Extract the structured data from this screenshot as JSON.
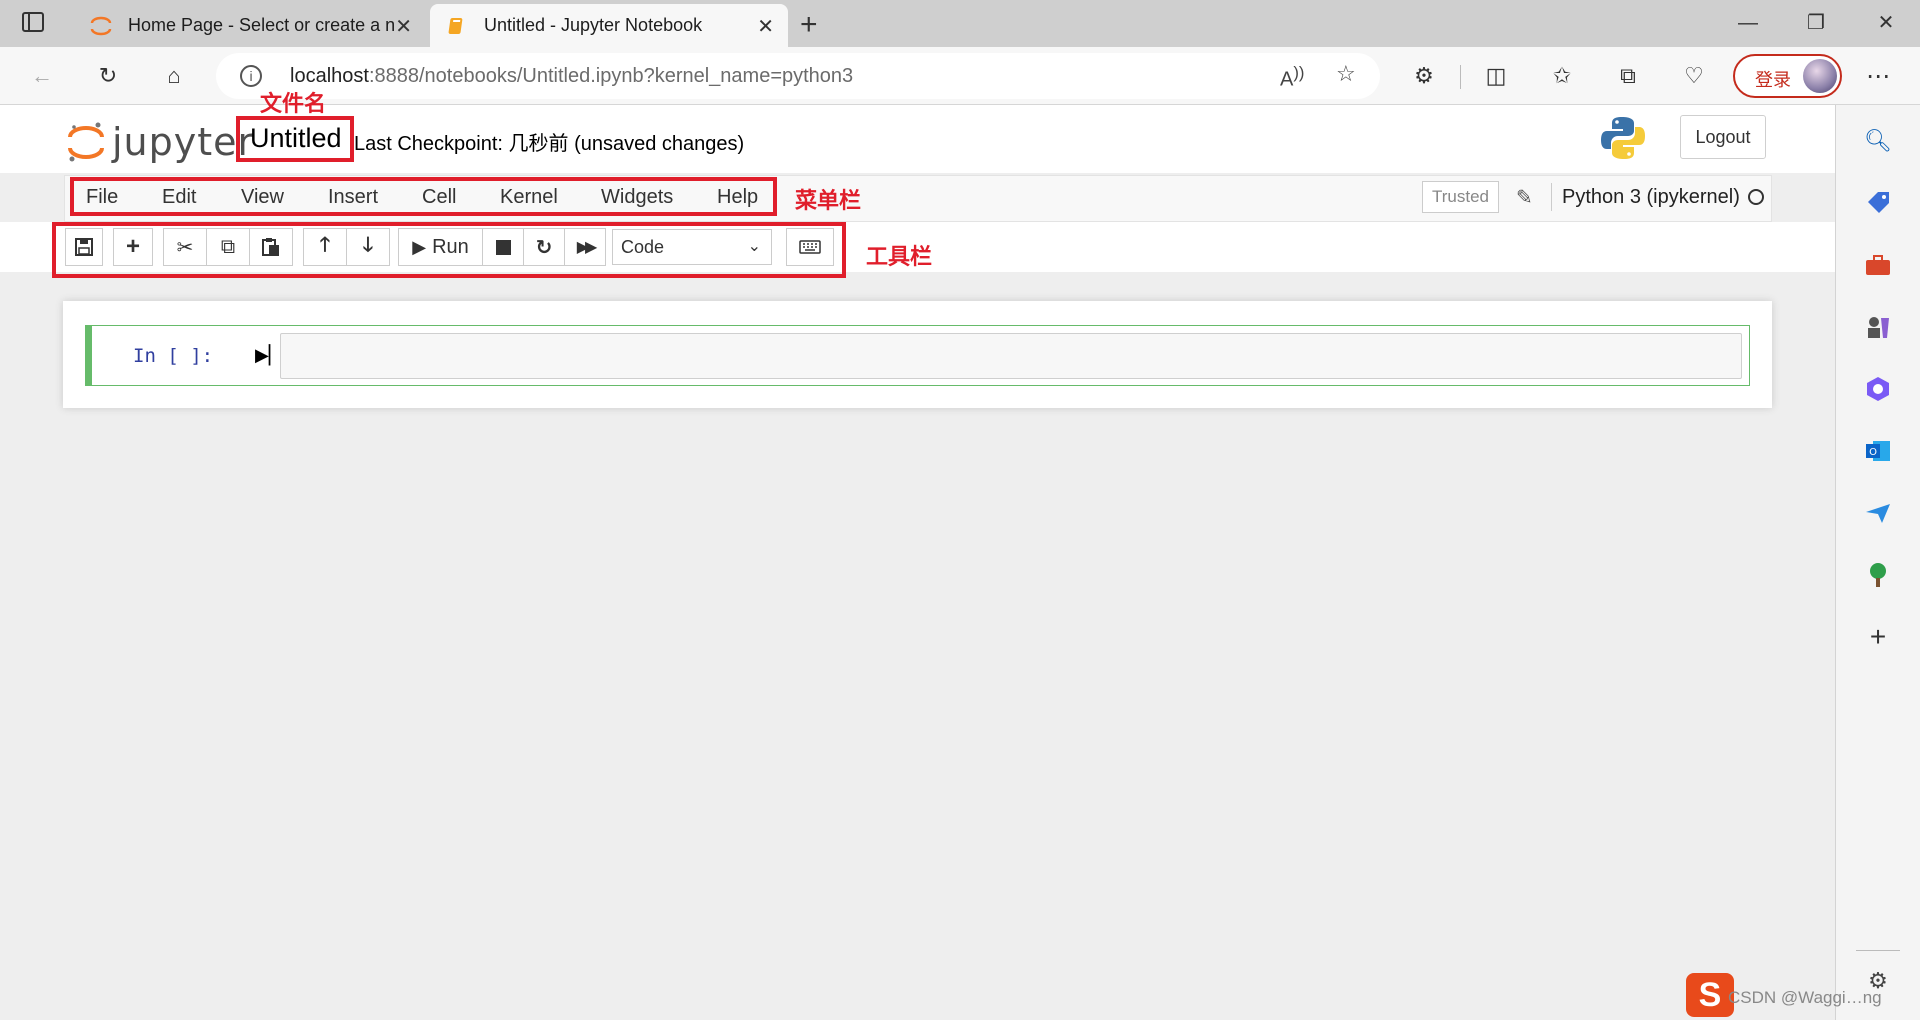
{
  "browser": {
    "tabs": [
      {
        "title": "Home Page - Select or create a n",
        "icon": "jupyter-icon",
        "active": false
      },
      {
        "title": "Untitled - Jupyter Notebook",
        "icon": "notebook-icon",
        "active": true
      }
    ],
    "url_host": "localhost",
    "url_rest": ":8888/notebooks/Untitled.ipynb?kernel_name=python3",
    "login_label": "登录"
  },
  "jupyter": {
    "logo_text": "jupyter",
    "notebook_name": "Untitled",
    "checkpoint_text": "Last Checkpoint: 几秒前  (unsaved changes)",
    "logout_label": "Logout",
    "menu": [
      "File",
      "Edit",
      "View",
      "Insert",
      "Cell",
      "Kernel",
      "Widgets",
      "Help"
    ],
    "trusted_label": "Trusted",
    "kernel_name": "Python 3 (ipykernel)",
    "toolbar": {
      "run_label": "Run",
      "cell_type": "Code"
    },
    "cell": {
      "prompt": "In [ ]:",
      "content": ""
    }
  },
  "annotations": {
    "filename": "文件名",
    "menubar": "菜单栏",
    "toolbar": "工具栏"
  },
  "watermark": {
    "logo_letter": "S",
    "text": "CSDN @Waggi…ng"
  },
  "colors": {
    "annotation_red": "#e01e2b",
    "cell_green": "#66bb6a",
    "prompt_blue": "#303f9f"
  }
}
